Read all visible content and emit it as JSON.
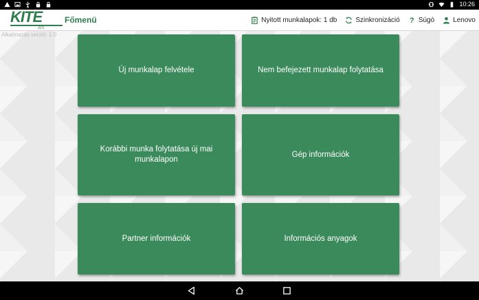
{
  "statusbar": {
    "time": "10:26",
    "icons_left": [
      "warning-icon",
      "image-icon",
      "usb-icon",
      "lock-icon",
      "lock-icon"
    ],
    "icons_right": [
      "vibrate-icon",
      "wifi-icon",
      "battery-icon"
    ]
  },
  "header": {
    "logo_text": "KITE",
    "logo_sub": "Zrt.",
    "title": "Főmenü",
    "actions": [
      {
        "icon": "clipboard-icon",
        "label": "Nyitott munkalapok: 1 db"
      },
      {
        "icon": "sync-icon",
        "label": "Szinkronizáció"
      },
      {
        "icon": "help-icon",
        "label": "Súgó"
      },
      {
        "icon": "user-icon",
        "label": "Lenovo"
      }
    ]
  },
  "version": "Alkalmazás verzió: 1.0",
  "tiles": [
    {
      "label": "Új munkalap felvétele"
    },
    {
      "label": "Nem befejezett munkalap folytatása"
    },
    {
      "label": "Korábbi munka folytatása új mai munkalapon"
    },
    {
      "label": "Gép információk"
    },
    {
      "label": "Partner információk"
    },
    {
      "label": "Információs anyagok"
    }
  ],
  "colors": {
    "brand_green": "#2e7d4c",
    "tile_green": "#3b8a5b"
  }
}
